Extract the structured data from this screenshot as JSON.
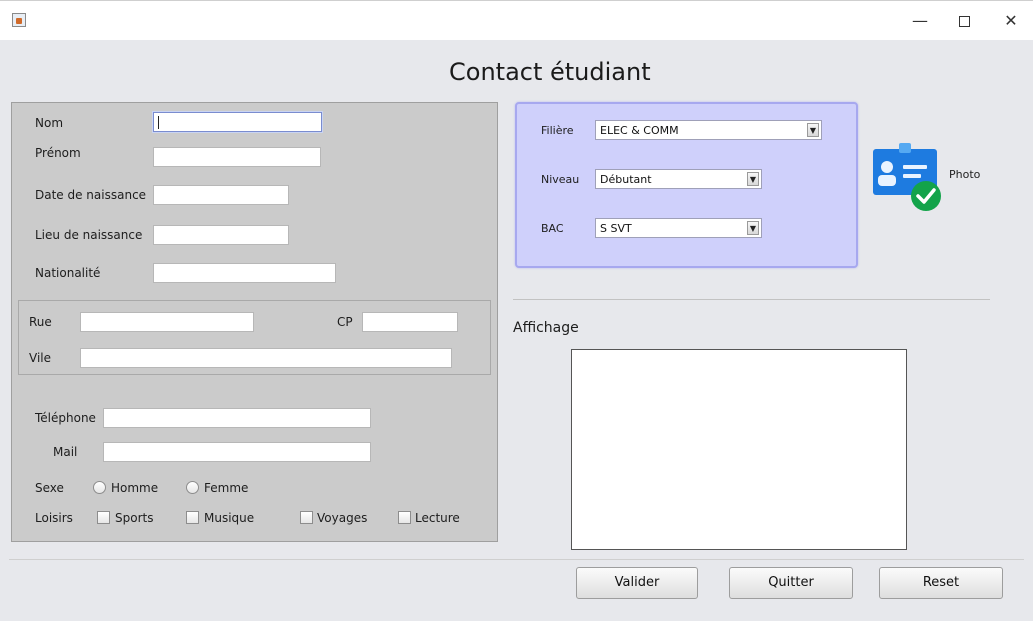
{
  "window": {
    "minimize_glyph": "—",
    "close_glyph": "✕"
  },
  "page_title": "Contact étudiant",
  "form": {
    "nom_label": "Nom",
    "prenom_label": "Prénom",
    "date_naissance_label": "Date de naissance",
    "lieu_naissance_label": "Lieu de naissance",
    "nationalite_label": "Nationalité",
    "rue_label": "Rue",
    "cp_label": "CP",
    "ville_label": "Vile",
    "telephone_label": "Téléphone",
    "mail_label": "Mail",
    "sexe_label": "Sexe",
    "sexe_options": [
      "Homme",
      "Femme"
    ],
    "loisirs_label": "Loisirs",
    "loisirs_options": [
      "Sports",
      "Musique",
      "Voyages",
      "Lecture"
    ],
    "values": {
      "nom": "",
      "prenom": "",
      "date_naissance": "",
      "lieu_naissance": "",
      "nationalite": "",
      "rue": "",
      "cp": "",
      "ville": "",
      "telephone": "",
      "mail": ""
    }
  },
  "selection": {
    "filiere_label": "Filière",
    "filiere_value": "ELEC & COMM",
    "niveau_label": "Niveau",
    "niveau_value": "Débutant",
    "bac_label": "BAC",
    "bac_value": "S SVT",
    "dropdown_arrow": "▼"
  },
  "photo_label": "Photo",
  "affichage_label": "Affichage",
  "buttons": {
    "valider": "Valider",
    "quitter": "Quitter",
    "reset": "Reset"
  },
  "colors": {
    "selection_panel_bg": "#cfd0fb",
    "form_panel_bg": "#cbcbcb",
    "photo_icon_blue": "#1e7be0",
    "photo_check_green": "#13a34a"
  }
}
